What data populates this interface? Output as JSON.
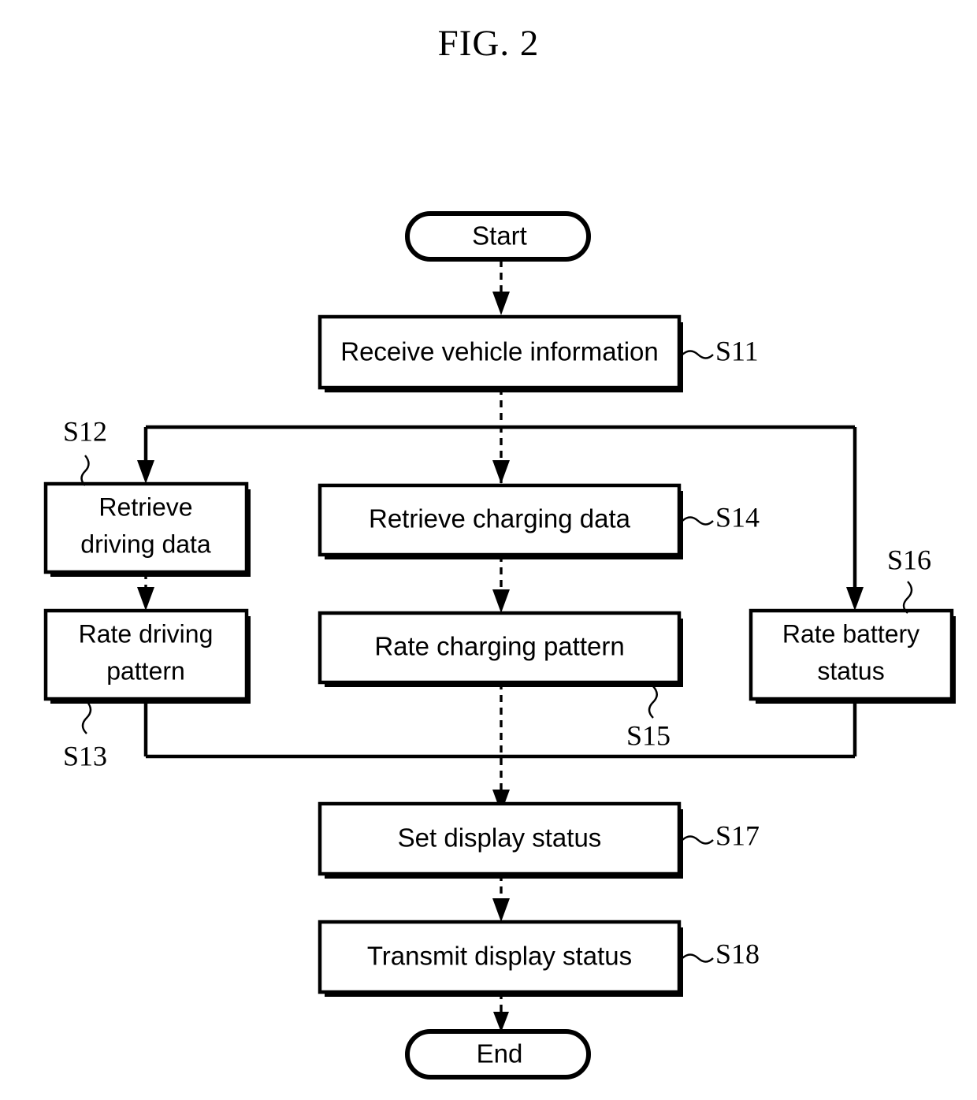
{
  "figure": {
    "title": "FIG. 2"
  },
  "diagram": {
    "type": "flowchart",
    "nodes": [
      {
        "id": "start",
        "label": "Start",
        "shape": "terminator",
        "ref": ""
      },
      {
        "id": "s11",
        "label": "Receive vehicle information",
        "shape": "process",
        "ref": "S11"
      },
      {
        "id": "s12",
        "label_line1": "Retrieve",
        "label_line2": "driving data",
        "shape": "process",
        "ref": "S12"
      },
      {
        "id": "s13",
        "label_line1": "Rate driving",
        "label_line2": "pattern",
        "shape": "process",
        "ref": "S13"
      },
      {
        "id": "s14",
        "label": "Retrieve charging data",
        "shape": "process",
        "ref": "S14"
      },
      {
        "id": "s15",
        "label": "Rate charging pattern",
        "shape": "process",
        "ref": "S15"
      },
      {
        "id": "s16",
        "label_line1": "Rate battery",
        "label_line2": "status",
        "shape": "process",
        "ref": "S16"
      },
      {
        "id": "s17",
        "label": "Set display status",
        "shape": "process",
        "ref": "S17"
      },
      {
        "id": "s18",
        "label": "Transmit display status",
        "shape": "process",
        "ref": "S18"
      },
      {
        "id": "end",
        "label": "End",
        "shape": "terminator",
        "ref": ""
      }
    ],
    "refs": {
      "s11": "S11",
      "s12": "S12",
      "s13": "S13",
      "s14": "S14",
      "s15": "S15",
      "s16": "S16",
      "s17": "S17",
      "s18": "S18"
    },
    "labels": {
      "start": "Start",
      "end": "End",
      "s11": "Receive vehicle information",
      "s12_l1": "Retrieve",
      "s12_l2": "driving data",
      "s13_l1": "Rate driving",
      "s13_l2": "pattern",
      "s14": "Retrieve charging data",
      "s15": "Rate charging pattern",
      "s16_l1": "Rate battery",
      "s16_l2": "status",
      "s17": "Set display status",
      "s18": "Transmit display status"
    },
    "colors": {
      "stroke": "#000000",
      "fill": "#ffffff",
      "background": "#ffffff"
    },
    "flow": [
      "Start -> Receive vehicle information (S11)",
      "S11 -> branch: Retrieve driving data (S12) | Retrieve charging data (S14) | Rate battery status (S16)",
      "S12 -> Rate driving pattern (S13)",
      "S14 -> Rate charging pattern (S15)",
      "S13, S15, S16 -> merge -> Set display status (S17)",
      "S17 -> Transmit display status (S18)",
      "S18 -> End"
    ]
  }
}
